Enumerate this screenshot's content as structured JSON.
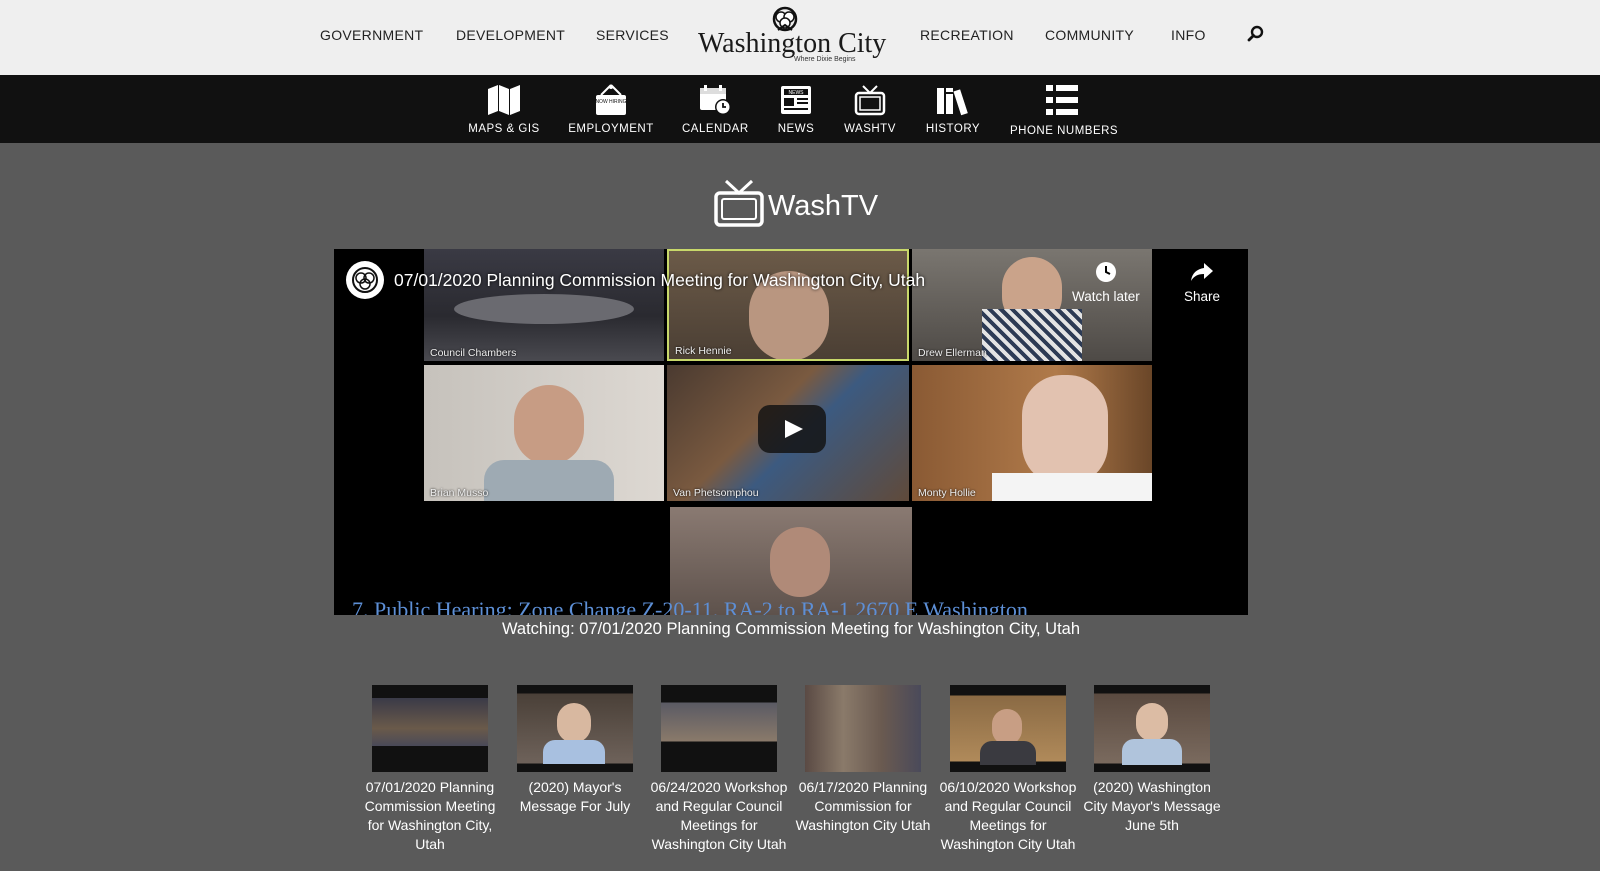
{
  "topnav": {
    "links": [
      "GOVERNMENT",
      "DEVELOPMENT",
      "SERVICES",
      "RECREATION",
      "COMMUNITY",
      "INFO"
    ],
    "logo_text": "Washington City",
    "logo_tagline": "Where Dixie Begins"
  },
  "quickbar": {
    "items": [
      {
        "label": "MAPS & GIS",
        "icon": "map-icon"
      },
      {
        "label": "EMPLOYMENT",
        "icon": "now-hiring-icon",
        "icon_text": "NOW HIRING"
      },
      {
        "label": "CALENDAR",
        "icon": "calendar-icon"
      },
      {
        "label": "NEWS",
        "icon": "newspaper-icon",
        "icon_text": "NEWS"
      },
      {
        "label": "WASHTV",
        "icon": "tv-icon"
      },
      {
        "label": "HISTORY",
        "icon": "books-icon"
      },
      {
        "label": "PHONE NUMBERS",
        "icon": "list-icon"
      }
    ]
  },
  "washtv": {
    "title": "WashTV"
  },
  "player": {
    "video_title": "07/01/2020 Planning Commission Meeting for Washington City, Utah",
    "watch_later_label": "Watch later",
    "share_label": "Share",
    "participants": [
      "Council Chambers",
      "Rick Hennie",
      "Drew Ellerman",
      "Brian Musso",
      "Van Phetsomphou",
      "Monty Hollie"
    ],
    "caption_text": "7. Public Hearing: Zone Change Z-20-11, RA-2 to RA-1 2670 E Washington"
  },
  "now_watching": "Watching: 07/01/2020 Planning Commission Meeting for Washington City, Utah",
  "playlist": [
    {
      "title": "07/01/2020 Planning Commission Meeting for Washington City, Utah"
    },
    {
      "title": "(2020) Mayor's Message For July"
    },
    {
      "title": "06/24/2020 Workshop and Regular Council Meetings for Washington City Utah"
    },
    {
      "title": "06/17/2020 Planning Commission for Washington City Utah"
    },
    {
      "title": "06/10/2020 Workshop and Regular Council Meetings for Washington City Utah"
    },
    {
      "title": "(2020) Washington City Mayor's Message June 5th"
    }
  ],
  "colors": {
    "page_bg": "#5a5a5a",
    "topnav_bg": "#efefef",
    "quickbar_bg": "#111111",
    "caption_blue": "#5d8fd6"
  }
}
